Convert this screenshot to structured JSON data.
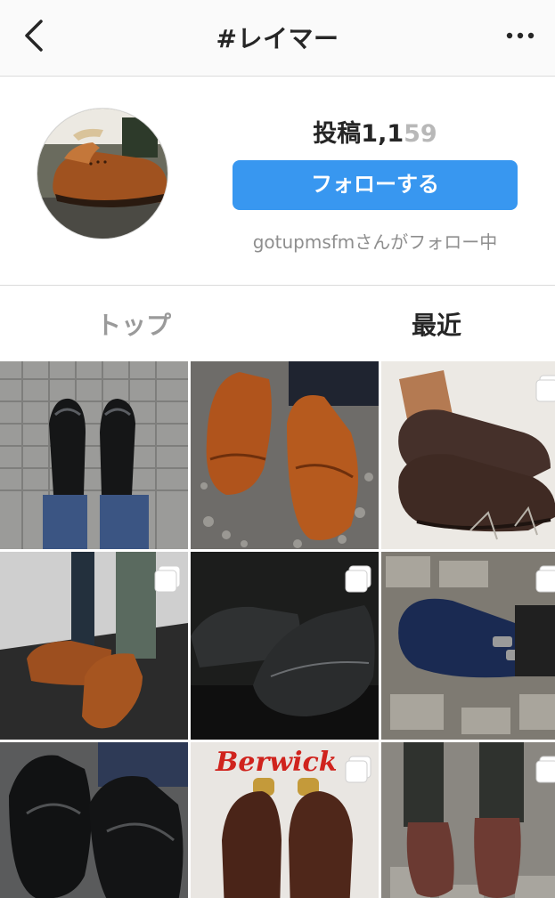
{
  "header": {
    "title": "#レイマー",
    "back_icon": "chevron-left-icon",
    "more_icon": "ellipsis-icon"
  },
  "profile": {
    "post_count_main": "投稿1,1",
    "post_count_faded": "59",
    "follow_label": "フォローする",
    "follow_note": "gotupmsfmさんがフォロー中",
    "accent_color": "#3897f0"
  },
  "tabs": [
    {
      "label": "トップ",
      "active": false
    },
    {
      "label": "最近",
      "active": true
    }
  ],
  "grid": {
    "posts": [
      {
        "desc": "black brogues on tile",
        "multi": false
      },
      {
        "desc": "tan brogues on gravel",
        "multi": false
      },
      {
        "desc": "dark brown captoe with shoetree",
        "multi": true
      },
      {
        "desc": "tan captoe on mat",
        "multi": true
      },
      {
        "desc": "black oxfords pair",
        "multi": true
      },
      {
        "desc": "navy double monk",
        "multi": true
      },
      {
        "desc": "black wingtips",
        "multi": false
      },
      {
        "desc": "brown oxfords Berwick",
        "multi": true
      },
      {
        "desc": "brown shoes on pavement",
        "multi": true
      }
    ],
    "photo_text": "Berwick"
  }
}
